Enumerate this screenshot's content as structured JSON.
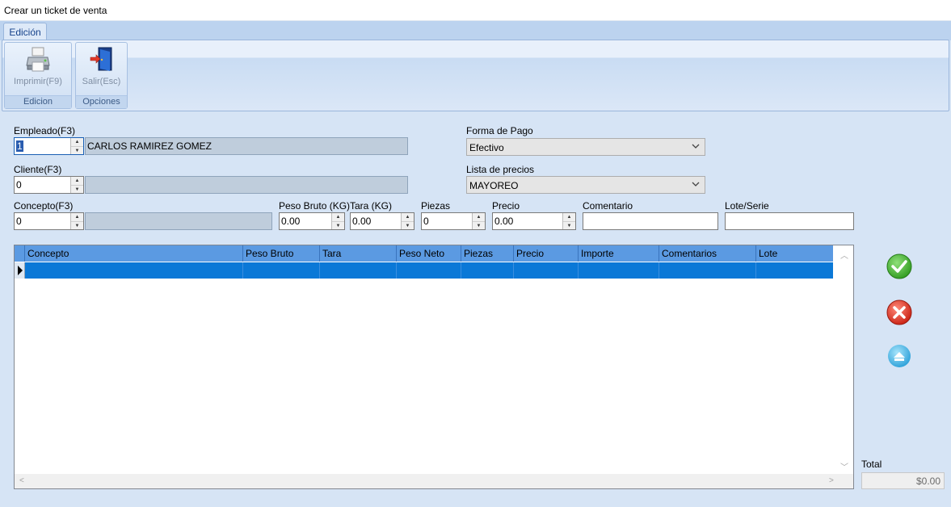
{
  "window": {
    "title": "Crear un ticket de venta"
  },
  "ribbon": {
    "tab": "Edición",
    "groups": [
      {
        "label": "Edicion",
        "button": "Imprimir(F9)",
        "icon": "printer-icon"
      },
      {
        "label": "Opciones",
        "button": "Salir(Esc)",
        "icon": "exit-door-icon"
      }
    ]
  },
  "form": {
    "empleado": {
      "label": "Empleado(F3)",
      "value": "1",
      "name": "CARLOS RAMIREZ GOMEZ"
    },
    "cliente": {
      "label": "Cliente(F3)",
      "value": "0",
      "name": ""
    },
    "concepto": {
      "label": "Concepto(F3)",
      "value": "0",
      "name": ""
    },
    "peso_bruto": {
      "label": "Peso Bruto (KG)",
      "value": "0.00"
    },
    "tara": {
      "label": "Tara (KG)",
      "value": "0.00"
    },
    "piezas": {
      "label": "Piezas",
      "value": "0"
    },
    "precio": {
      "label": "Precio",
      "value": "0.00"
    },
    "comentario": {
      "label": "Comentario",
      "value": ""
    },
    "lote": {
      "label": "Lote/Serie",
      "value": ""
    },
    "forma_pago": {
      "label": "Forma de Pago",
      "value": "Efectivo"
    },
    "lista_precios": {
      "label": "Lista de precios",
      "value": "MAYOREO"
    }
  },
  "grid": {
    "columns": [
      "Concepto",
      "Peso Bruto",
      "Tara",
      "Peso Neto",
      "Piezas",
      "Precio",
      "Importe",
      "Comentarios",
      "Lote"
    ]
  },
  "actions": {
    "accept_icon": "check-icon",
    "cancel_icon": "cancel-icon",
    "upload_icon": "upload-icon"
  },
  "total": {
    "label": "Total",
    "value": "$0.00"
  }
}
